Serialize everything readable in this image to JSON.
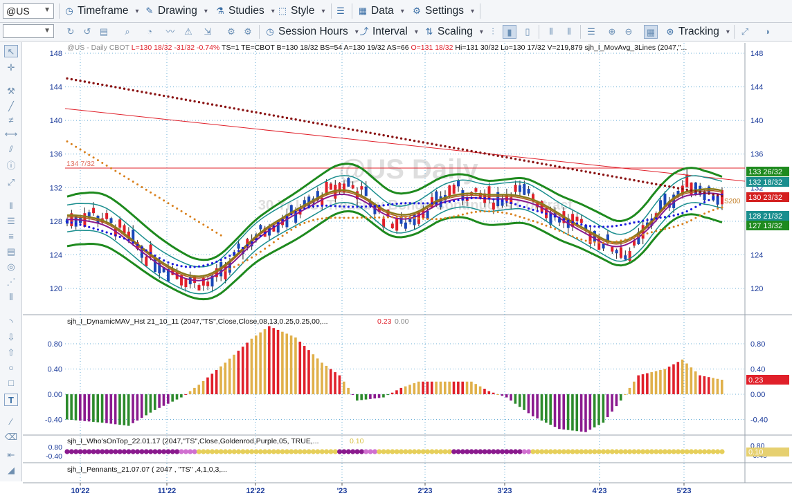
{
  "toolbar1": {
    "symbol": "@US",
    "timeframe": "Timeframe",
    "drawing": "Drawing",
    "studies": "Studies",
    "style": "Style",
    "data": "Data",
    "settings": "Settings"
  },
  "toolbar2": {
    "session_hours": "Session Hours",
    "interval": "Interval",
    "scaling": "Scaling",
    "tracking": "Tracking"
  },
  "chart": {
    "header": {
      "symbol": "@US - Daily  CBOT",
      "last": "L=130 18/32",
      "change": "-31/32",
      "pct": "-0.74%",
      "rest": "TS=1  TE=CBOT  B=130 18/32  BS=54  A=130 19/32  AS=66",
      "open": "O=131 18/32",
      "rest2": "Hi=131 30/32  Lo=130 17/32  V=219,879  sjh_I_MovAvg_3Lines (2047,\"..."
    },
    "watermark": "@US Daily",
    "watermark2": "30 Yr U.S. Treasury Bonds Continuous Contract",
    "hline_label": "134 7/32",
    "price_axis_ticks": [
      "148",
      "144",
      "140",
      "136",
      "132",
      "128",
      "124",
      "120"
    ],
    "price_tags": [
      {
        "text": "133 26/32",
        "color": "#1e8a1e"
      },
      {
        "text": "132 18/32",
        "color": "#1a8e8e"
      },
      {
        "text": "130 23/32",
        "color": "#d42020"
      },
      {
        "text": "128 21/32",
        "color": "#1a8e8e"
      },
      {
        "text": "127 13/32",
        "color": "#1e8a1e"
      }
    ],
    "end_label": "S200",
    "dates": [
      "10'22",
      "11'22",
      "12'22",
      "'23",
      "2'23",
      "3'23",
      "4'23",
      "5'23"
    ]
  },
  "panel2": {
    "title": "sjh_I_DynamicMAV_Hst 21_10_11 (2047,\"TS\",Close,Close,08,13,0.25,0.25,00,...",
    "val1": "0.23",
    "val2": "0.00",
    "ticks": [
      "0.80",
      "0.40",
      "0.00",
      "-0.40"
    ],
    "tag": "0.23"
  },
  "panel3": {
    "title": "sjh_I_Who'sOnTop_22.01.17 (2047,\"TS\",Close,Goldenrod,Purple,05, TRUE,...",
    "val": "0.10",
    "left_ticks": [
      "0.80",
      "-0.40"
    ],
    "right_ticks": [
      "0.80",
      "-0.40"
    ],
    "tag": "0.10"
  },
  "panel4": {
    "title": "sjh_I_Pennants_21.07.07 ( 2047 , \"TS\" ,4,1,0,3,..."
  },
  "colors": {
    "up_candle": "#1a47b8",
    "down_candle": "#e0202a",
    "band_outer": "#1e8a1e",
    "band_inner": "#1a8e8e",
    "ma_dots_blue": "#1b1bdc",
    "ma_dots_orange": "#d9801c",
    "ma_dots_maroon": "#8b1515",
    "hist_gold": "#e0b04a",
    "hist_red": "#e0202a",
    "hist_purple": "#8a1a8e",
    "hist_green": "#2c8a2c"
  }
}
